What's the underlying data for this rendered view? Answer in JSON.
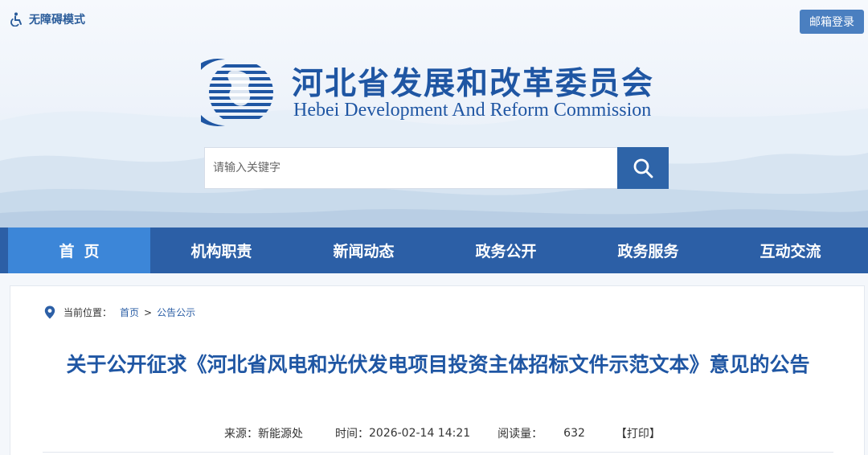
{
  "header": {
    "accessibility_label": "无障碍模式",
    "mail_login_label": "邮箱登录",
    "site_title_cn": "河北省发展和改革委员会",
    "site_title_en": "Hebei Development And Reform Commission",
    "search_placeholder": "请输入关键字"
  },
  "nav": {
    "items": [
      {
        "label": "首页"
      },
      {
        "label": "机构职责"
      },
      {
        "label": "新闻动态"
      },
      {
        "label": "政务公开"
      },
      {
        "label": "政务服务"
      },
      {
        "label": "互动交流"
      }
    ],
    "active_index": 0
  },
  "breadcrumb": {
    "prefix": "当前位置：",
    "items": [
      "首页",
      "公告公示"
    ],
    "separator": ">"
  },
  "article": {
    "title": "关于公开征求《河北省风电和光伏发电项目投资主体招标文件示范文本》意见的公告",
    "source_label": "来源：",
    "source_value": "新能源处",
    "time_label": "时间：",
    "time_value": "2026-02-14 14:21",
    "views_label": "阅读量：",
    "views_value": "632",
    "print_label": "【打印】"
  },
  "colors": {
    "brand_blue": "#2c5fa6",
    "nav_active": "#3c86d8",
    "title_blue": "#1f56a3",
    "mail_button": "#4a7fc0"
  },
  "icons": {
    "accessibility": "wheelchair-icon",
    "search": "search-icon",
    "location": "location-pin-icon"
  }
}
